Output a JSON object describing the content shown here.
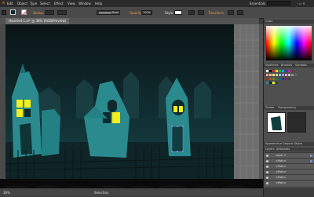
{
  "menu": {
    "logo": "Ai",
    "items": [
      "Edit",
      "Object",
      "Type",
      "Select",
      "Effect",
      "View",
      "Window",
      "Help"
    ],
    "workspace": "Essentials"
  },
  "control_bar": {
    "stroke_label": "Stroke:",
    "brush_value": "Basic",
    "opacity_label": "Opacity:",
    "opacity_value": "100%",
    "style_label": "Style:",
    "transform_label": "Transform"
  },
  "document": {
    "tab_title": "Haunted-1.ai* @ 38% (RGB/Preview)"
  },
  "status": {
    "zoom": "38%",
    "tool": "Selection"
  },
  "panels": {
    "color_tab": "Color",
    "swatches_tabs": [
      "Swatches",
      "Brushes",
      "Symbols"
    ],
    "transparency_tabs": [
      "Stroke",
      "Transparency"
    ],
    "appearance_tabs": [
      "Appearance",
      "Graphic Styles"
    ],
    "layers_tabs": [
      "Layers",
      "Artboards"
    ],
    "layer_names": [
      "Layer 1",
      "<Path>",
      "<Path>",
      "<Path>",
      "<Path>",
      "<Path>"
    ]
  },
  "colors": {
    "accent_orange": "#e8973a",
    "sky": "#0e2a2c",
    "house": "#2a8a8e",
    "window": "#f4ef1a",
    "selection": "#6d8fc6"
  }
}
